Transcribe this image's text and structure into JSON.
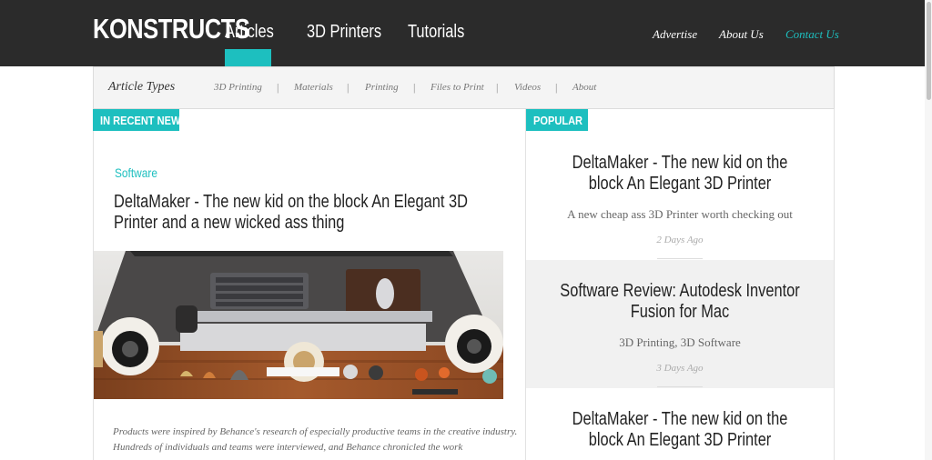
{
  "header": {
    "logo": "KONSTRUCTS",
    "main_nav": [
      "Articles",
      "3D Printers",
      "Tutorials"
    ],
    "active_nav": "Articles",
    "util_nav": [
      "Advertise",
      "About Us",
      "Contact Us"
    ]
  },
  "subnav": {
    "title": "Article Types",
    "items": [
      "3D Printing",
      "Materials",
      "Printing",
      "Files to Print",
      "Videos",
      "About"
    ]
  },
  "recent": {
    "badge": "IN RECENT NEWS",
    "category": "Software",
    "title": "DeltaMaker - The new kid on the block An Elegant 3D Printer and a new wicked ass thing",
    "excerpt": "Products were inspired by Behance's research of especially productive teams in the creative industry. Hundreds of individuals and teams were interviewed, and Behance chronicled the work"
  },
  "popular": {
    "badge": "POPULAR",
    "items": [
      {
        "title": "DeltaMaker - The new kid on the block An Elegant 3D Printer",
        "subtitle": "A new cheap ass 3D Printer worth checking out",
        "date": "2 Days Ago"
      },
      {
        "title": "Software Review: Autodesk Inventor Fusion for Mac",
        "subtitle": "3D Printing, 3D Software",
        "date": "3 Days Ago"
      },
      {
        "title": "DeltaMaker - The new kid on the block An Elegant 3D Printer",
        "subtitle": "",
        "date": ""
      }
    ]
  },
  "colors": {
    "accent": "#1dbfbf",
    "header_bg": "#2b2b2b"
  }
}
